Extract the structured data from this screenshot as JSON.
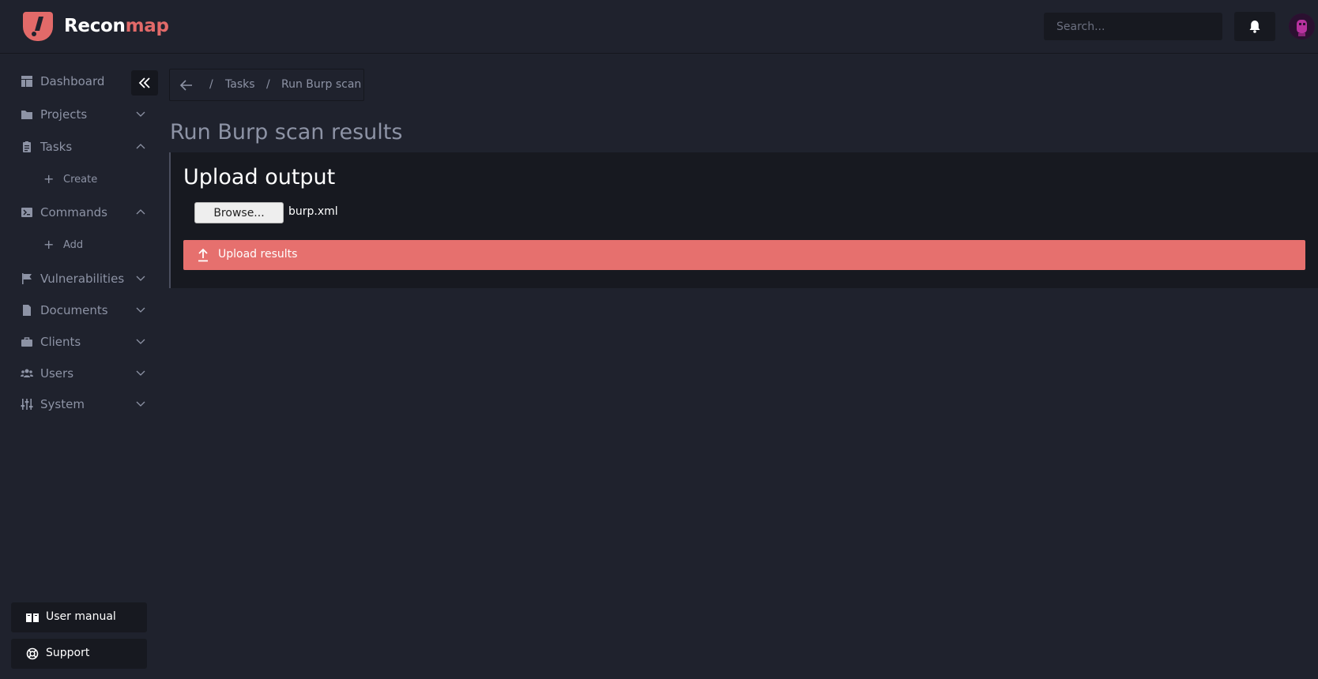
{
  "app": {
    "brand_primary": "Recon",
    "brand_accent": "map",
    "accent_color": "#e26a69"
  },
  "header": {
    "search_placeholder": "Search...",
    "notification_icon": "bell-icon",
    "avatar_icon": "user-avatar"
  },
  "sidebar": {
    "items": [
      {
        "label": "Dashboard",
        "icon": "dashboard-icon"
      },
      {
        "label": "Projects",
        "icon": "folder-icon"
      },
      {
        "label": "Tasks",
        "icon": "clipboard-icon"
      },
      {
        "label": "Create",
        "icon": "plus-icon"
      },
      {
        "label": "Commands",
        "icon": "terminal-icon"
      },
      {
        "label": "Add",
        "icon": "plus-icon"
      },
      {
        "label": "Vulnerabilities",
        "icon": "flag-icon"
      },
      {
        "label": "Documents",
        "icon": "document-icon"
      },
      {
        "label": "Clients",
        "icon": "briefcase-icon"
      },
      {
        "label": "Users",
        "icon": "users-icon"
      },
      {
        "label": "System",
        "icon": "sliders-icon"
      }
    ],
    "user_manual": "User manual",
    "support": "Support"
  },
  "breadcrumb": {
    "separator": "/",
    "tasks": "Tasks",
    "current": "Run Burp scan"
  },
  "main": {
    "page_title": "Run Burp scan results",
    "panel_title": "Upload output",
    "browse_label": "Browse...",
    "file_name": "burp.xml",
    "upload_label": "Upload results"
  }
}
